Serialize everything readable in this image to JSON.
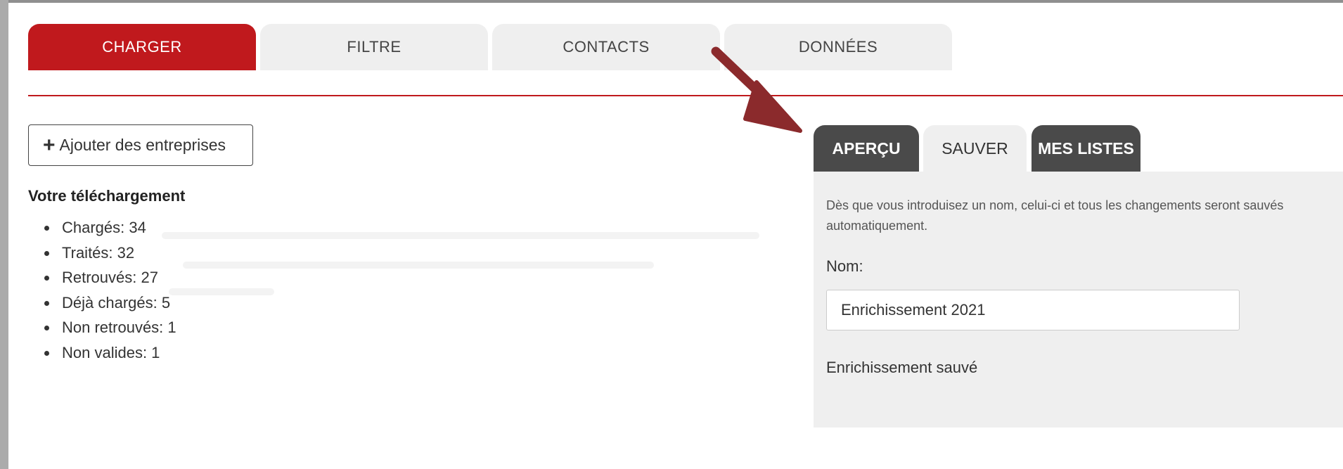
{
  "main_tabs": [
    {
      "label": "CHARGER",
      "active": true
    },
    {
      "label": "FILTRE",
      "active": false
    },
    {
      "label": "CONTACTS",
      "active": false
    },
    {
      "label": "DONNÉES",
      "active": false
    }
  ],
  "add_button": {
    "label": "Ajouter des entreprises",
    "icon": "plus-icon"
  },
  "upload": {
    "title": "Votre téléchargement",
    "stats": [
      "Chargés: 34",
      "Traités: 32",
      "Retrouvés: 27",
      "Déjà chargés: 5",
      "Non retrouvés: 1",
      "Non valides: 1"
    ]
  },
  "sub_tabs": [
    {
      "label": "APERÇU",
      "style": "dark"
    },
    {
      "label": "SAUVER",
      "style": "light"
    },
    {
      "label": "MES LISTES",
      "style": "dark"
    }
  ],
  "save_panel": {
    "description": "Dès que vous introduisez un nom, celui-ci et tous les changements seront sauvés automatiquement.",
    "name_label": "Nom:",
    "name_value": "Enrichissement 2021",
    "saved_message": "Enrichissement sauvé"
  },
  "colors": {
    "accent": "#c0191d",
    "dark_tab": "#4a4a4a",
    "light_tab": "#efefef",
    "arrow": "#8b2a2c"
  }
}
